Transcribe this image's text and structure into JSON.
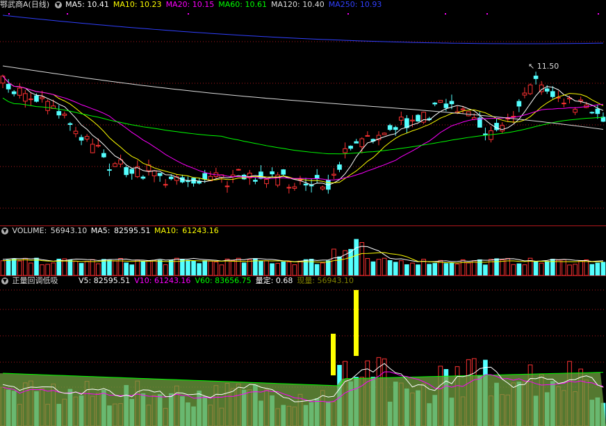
{
  "panel1": {
    "title": "鄂武商A",
    "period": "(日线)",
    "ma": [
      {
        "label": "MA5:",
        "value": "10.41",
        "color": "#ffffff"
      },
      {
        "label": "MA10:",
        "value": "10.23",
        "color": "#ffff00"
      },
      {
        "label": "MA20:",
        "value": "10.15",
        "color": "#ff00ff"
      },
      {
        "label": "MA60:",
        "value": "10.61",
        "color": "#00ff00"
      },
      {
        "label": "MA120:",
        "value": "10.40",
        "color": "#dddddd"
      },
      {
        "label": "MA250:",
        "value": "10.93",
        "color": "#3040ff"
      }
    ],
    "high_label": "11.50"
  },
  "panel2": {
    "volume_label": "VOLUME:",
    "volume_value": "56943.10",
    "ma5_label": "MA5:",
    "ma5_value": "82595.51",
    "ma10_label": "MA10:",
    "ma10_value": "61243.16"
  },
  "panel3": {
    "name": "正量回调低吸",
    "items": [
      {
        "label": "V5:",
        "value": "82595.51",
        "color": "#ffffff"
      },
      {
        "label": "V10:",
        "value": "61243.16",
        "color": "#ff00ff"
      },
      {
        "label": "V60:",
        "value": "83656.75",
        "color": "#00ff00"
      },
      {
        "label": "量定:",
        "value": "0.68",
        "color": "#ffffff"
      },
      {
        "label": "现量:",
        "value": "56943.10",
        "color": "#808000"
      }
    ]
  },
  "colors": {
    "up": "#ff3232",
    "down": "#54ffff",
    "ma5": "#ffffff",
    "ma10": "#ffff00",
    "ma20": "#ff00ff",
    "ma60": "#00ff00",
    "ma120": "#dddddd",
    "ma250": "#3040ff",
    "grid": "#b0181c"
  },
  "icons": {
    "collapse": "circle-chevron-down-icon"
  }
}
